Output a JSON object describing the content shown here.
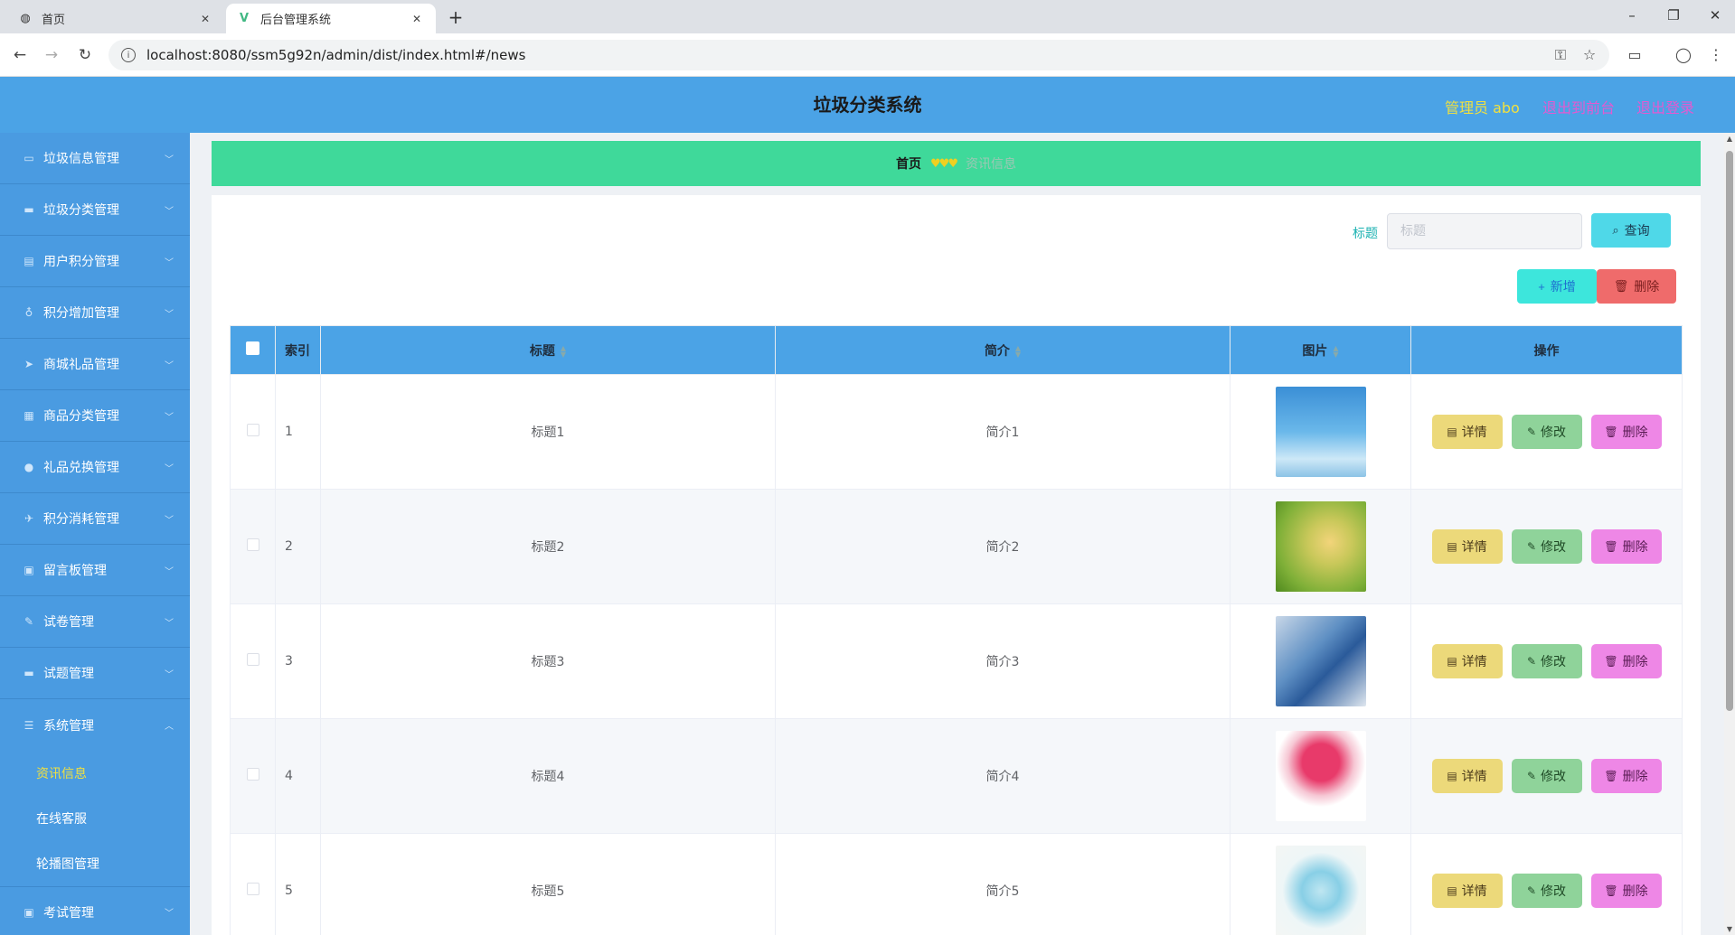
{
  "browser": {
    "tabs": [
      {
        "label": "首页",
        "favicon": "globe-icon"
      },
      {
        "label": "后台管理系统",
        "favicon": "vue-icon"
      }
    ],
    "url": "localhost:8080/ssm5g92n/admin/dist/index.html#/news"
  },
  "header": {
    "title": "垃圾分类系统",
    "user": "管理员 abo",
    "front_link": "退出到前台",
    "logout_link": "退出登录",
    "colors": {
      "bar": "#4ba3e6",
      "user": "#f0e040",
      "links": "#e35ad1"
    }
  },
  "sidebar": {
    "items": [
      {
        "label": "垃圾信息管理",
        "icon": "chat-icon"
      },
      {
        "label": "垃圾分类管理",
        "icon": "message-icon"
      },
      {
        "label": "用户积分管理",
        "icon": "chart-icon"
      },
      {
        "label": "积分增加管理",
        "icon": "mic-icon"
      },
      {
        "label": "商城礼品管理",
        "icon": "send-icon"
      },
      {
        "label": "商品分类管理",
        "icon": "building-icon"
      },
      {
        "label": "礼品兑换管理",
        "icon": "user-icon"
      },
      {
        "label": "积分消耗管理",
        "icon": "plane-icon"
      },
      {
        "label": "留言板管理",
        "icon": "clipboard-icon"
      },
      {
        "label": "试卷管理",
        "icon": "edit-icon"
      },
      {
        "label": "试题管理",
        "icon": "tablet-icon"
      },
      {
        "label": "系统管理",
        "icon": "list-icon",
        "expanded": true
      }
    ],
    "subitems": [
      {
        "label": "资讯信息",
        "active": true
      },
      {
        "label": "在线客服"
      },
      {
        "label": "轮播图管理"
      }
    ],
    "last_item": {
      "label": "考试管理",
      "icon": "clipboard-icon"
    }
  },
  "breadcrumb": {
    "home": "首页",
    "separator": "♥♥♥",
    "current": "资讯信息"
  },
  "search": {
    "label": "标题",
    "placeholder": "标题",
    "query_button": "查询"
  },
  "actions": {
    "add_button": "新增",
    "delete_button": "删除"
  },
  "table": {
    "columns": [
      "索引",
      "标题",
      "简介",
      "图片",
      "操作"
    ],
    "rows": [
      {
        "index": "1",
        "title": "标题1",
        "intro": "简介1",
        "image": "sky-ladder-image"
      },
      {
        "index": "2",
        "title": "标题2",
        "intro": "简介2",
        "image": "wooden-heart-image"
      },
      {
        "index": "3",
        "title": "标题3",
        "intro": "简介3",
        "image": "medical-tablet-image"
      },
      {
        "index": "4",
        "title": "标题4",
        "intro": "简介4",
        "image": "heart-tree-image"
      },
      {
        "index": "5",
        "title": "标题5",
        "intro": "简介5",
        "image": "heart-flower-image"
      }
    ],
    "row_actions": {
      "detail": "详情",
      "edit": "修改",
      "delete": "删除"
    }
  }
}
